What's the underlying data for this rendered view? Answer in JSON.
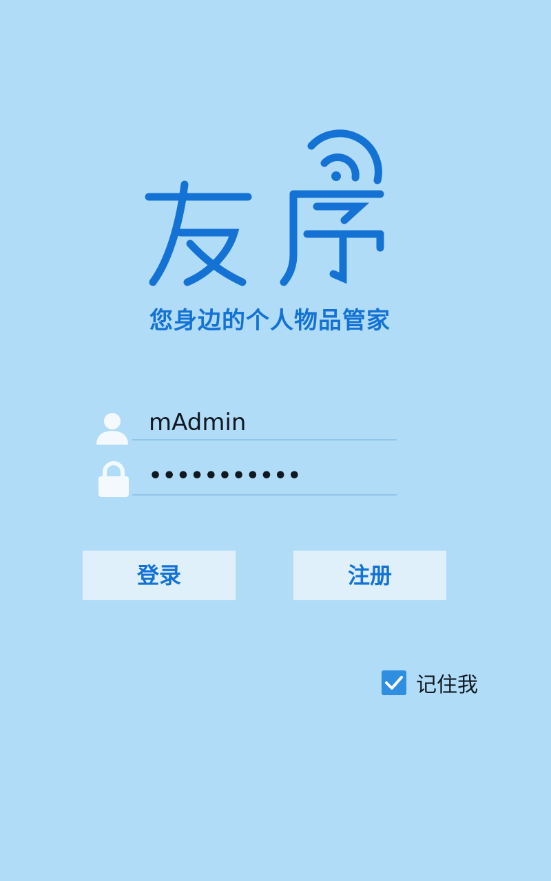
{
  "logo": {
    "text": "友序",
    "slogan": "您身边的个人物品管家"
  },
  "login_form": {
    "username": {
      "value": "mAdmin",
      "icon": "user-icon"
    },
    "password": {
      "masked_value": "•••••••••••",
      "icon": "lock-icon"
    },
    "login_button": "登录",
    "register_button": "注册",
    "remember_me": {
      "label": "记住我",
      "checked": true
    }
  },
  "colors": {
    "background": "#b1dcf8",
    "brand_blue": "#1372d3",
    "button_bg": "#dff0fb",
    "checkbox": "#2f8ee0"
  }
}
